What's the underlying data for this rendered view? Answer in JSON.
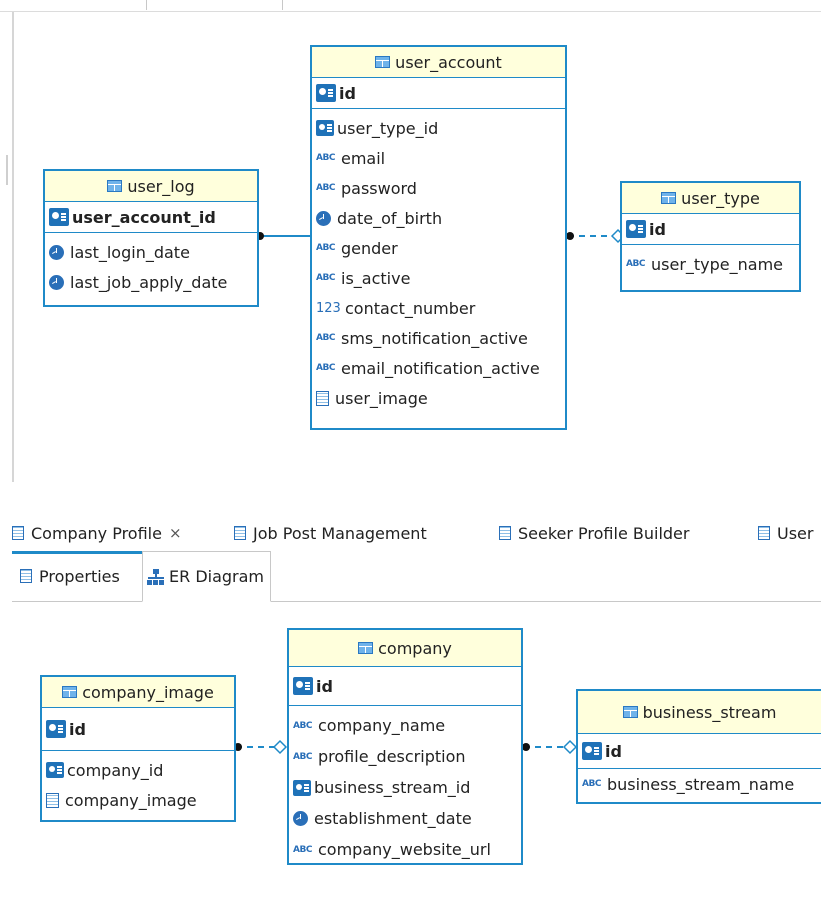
{
  "diagram_top": {
    "tables": [
      {
        "name": "user_log",
        "pk": "user_account_id",
        "columns": [
          {
            "icon": "date-icon",
            "name": "last_login_date"
          },
          {
            "icon": "date-icon",
            "name": "last_job_apply_date"
          }
        ]
      },
      {
        "name": "user_account",
        "pk": "id",
        "columns": [
          {
            "icon": "foreign-key-icon",
            "name": "user_type_id"
          },
          {
            "icon": "text-type-icon",
            "name": "email"
          },
          {
            "icon": "text-type-icon",
            "name": "password"
          },
          {
            "icon": "date-icon",
            "name": "date_of_birth"
          },
          {
            "icon": "text-type-icon",
            "name": "gender"
          },
          {
            "icon": "text-type-icon",
            "name": "is_active"
          },
          {
            "icon": "number-type-icon",
            "name": "contact_number"
          },
          {
            "icon": "text-type-icon",
            "name": "sms_notification_active"
          },
          {
            "icon": "text-type-icon",
            "name": "email_notification_active"
          },
          {
            "icon": "binary-type-icon",
            "name": "user_image"
          }
        ]
      },
      {
        "name": "user_type",
        "pk": "id",
        "columns": [
          {
            "icon": "text-type-icon",
            "name": "user_type_name"
          }
        ]
      }
    ]
  },
  "tabs": [
    {
      "label": "Company Profile",
      "active": true,
      "close": "×"
    },
    {
      "label": "Job Post Management"
    },
    {
      "label": "Seeker Profile Builder"
    },
    {
      "label": "User"
    }
  ],
  "subtabs": [
    {
      "label": "Properties"
    },
    {
      "label": "ER Diagram",
      "selected": true
    }
  ],
  "diagram_bottom": {
    "tables": [
      {
        "name": "company_image",
        "pk": "id",
        "columns": [
          {
            "icon": "foreign-key-icon",
            "name": "company_id"
          },
          {
            "icon": "binary-type-icon",
            "name": "company_image"
          }
        ]
      },
      {
        "name": "company",
        "pk": "id",
        "columns": [
          {
            "icon": "text-type-icon",
            "name": "company_name"
          },
          {
            "icon": "text-type-icon",
            "name": "profile_description"
          },
          {
            "icon": "foreign-key-icon",
            "name": "business_stream_id"
          },
          {
            "icon": "date-icon",
            "name": "establishment_date"
          },
          {
            "icon": "text-type-icon",
            "name": "company_website_url"
          }
        ]
      },
      {
        "name": "business_stream",
        "pk": "id",
        "columns": [
          {
            "icon": "text-type-icon",
            "name": "business_stream_name"
          }
        ]
      }
    ]
  },
  "glyphs": {
    "abc": "ABC",
    "num": "123"
  },
  "colors": {
    "table_border": "#1f8ac8",
    "table_header_bg": "#ffffdc",
    "icon_blue": "#2a6fb8"
  }
}
